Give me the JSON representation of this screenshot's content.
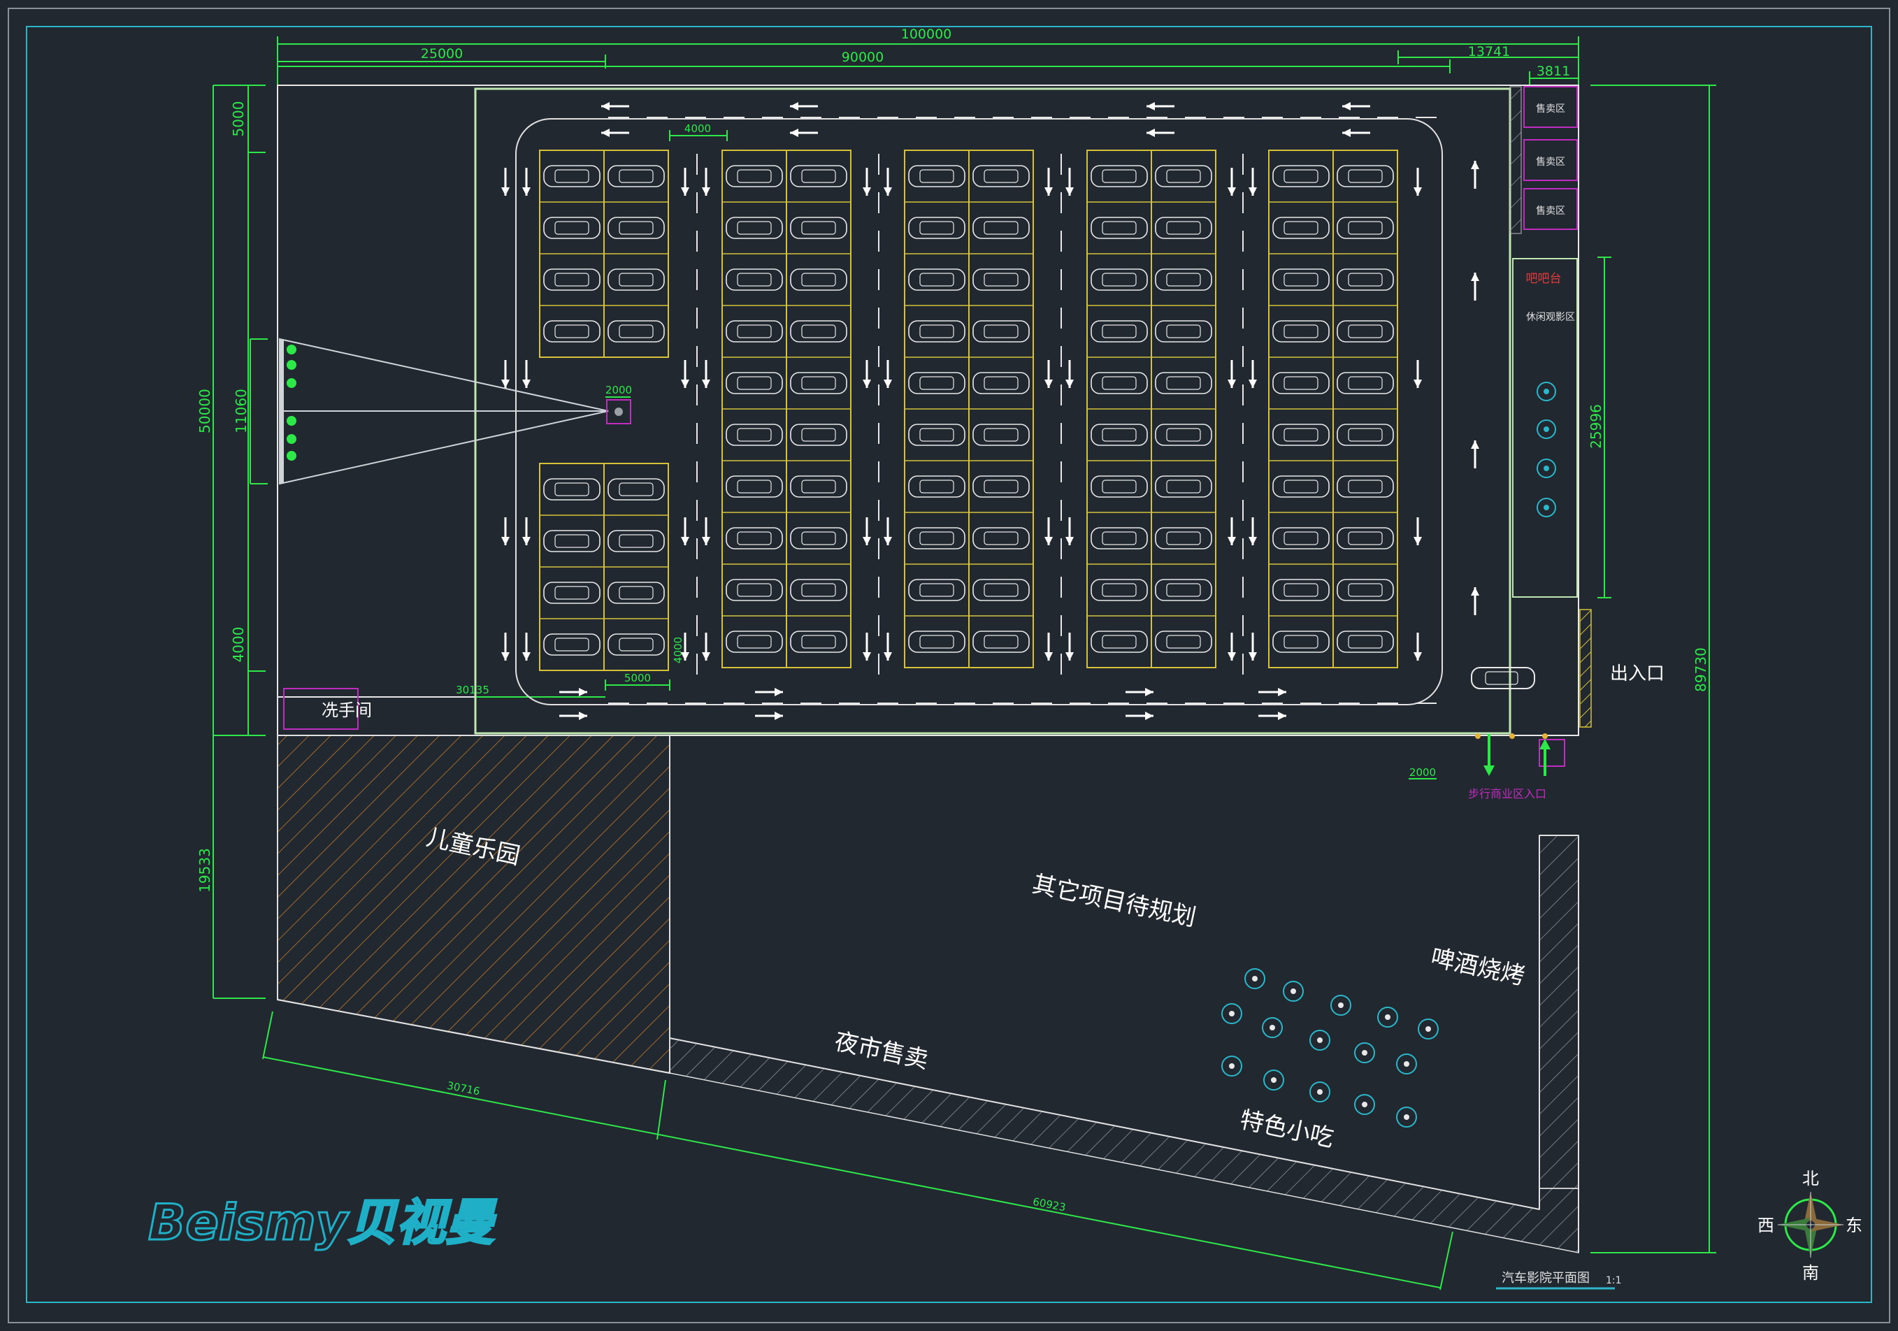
{
  "drawing": {
    "title": "汽车影院平面图",
    "scale": "1:1",
    "brand": "Beismy贝视曼"
  },
  "dimensions": {
    "total_width": "100000",
    "left_width": "25000",
    "mid_width": "90000",
    "right_a": "13741",
    "right_b": "3811",
    "stall_spacing": "4000",
    "left_top": "5000",
    "left_height": "50000",
    "screen_height": "11060",
    "left_bottom": "4000",
    "kids_height": "19533",
    "total_height": "89730",
    "lounge_height": "25996",
    "projector_w": "2000",
    "stall_width": "5000",
    "stall_depth": "4000",
    "lane_length": "30135",
    "ticket_w": "2000",
    "diag_a": "30716",
    "diag_b": "60923"
  },
  "labels": {
    "washroom": "冼手间",
    "entrance": "出入口",
    "pedestrian_entrance": "步行商业区入口",
    "kids_park": "儿童乐园",
    "other_projects": "其它项目待规划",
    "beer_bbq": "啤酒烧烤",
    "night_market": "夜市售卖",
    "snacks": "特色小吃",
    "sales_area": "售卖区",
    "bar": "吧吧台",
    "lounge": "休闲观影区",
    "north": "北",
    "south": "南",
    "east": "东",
    "west": "西"
  }
}
